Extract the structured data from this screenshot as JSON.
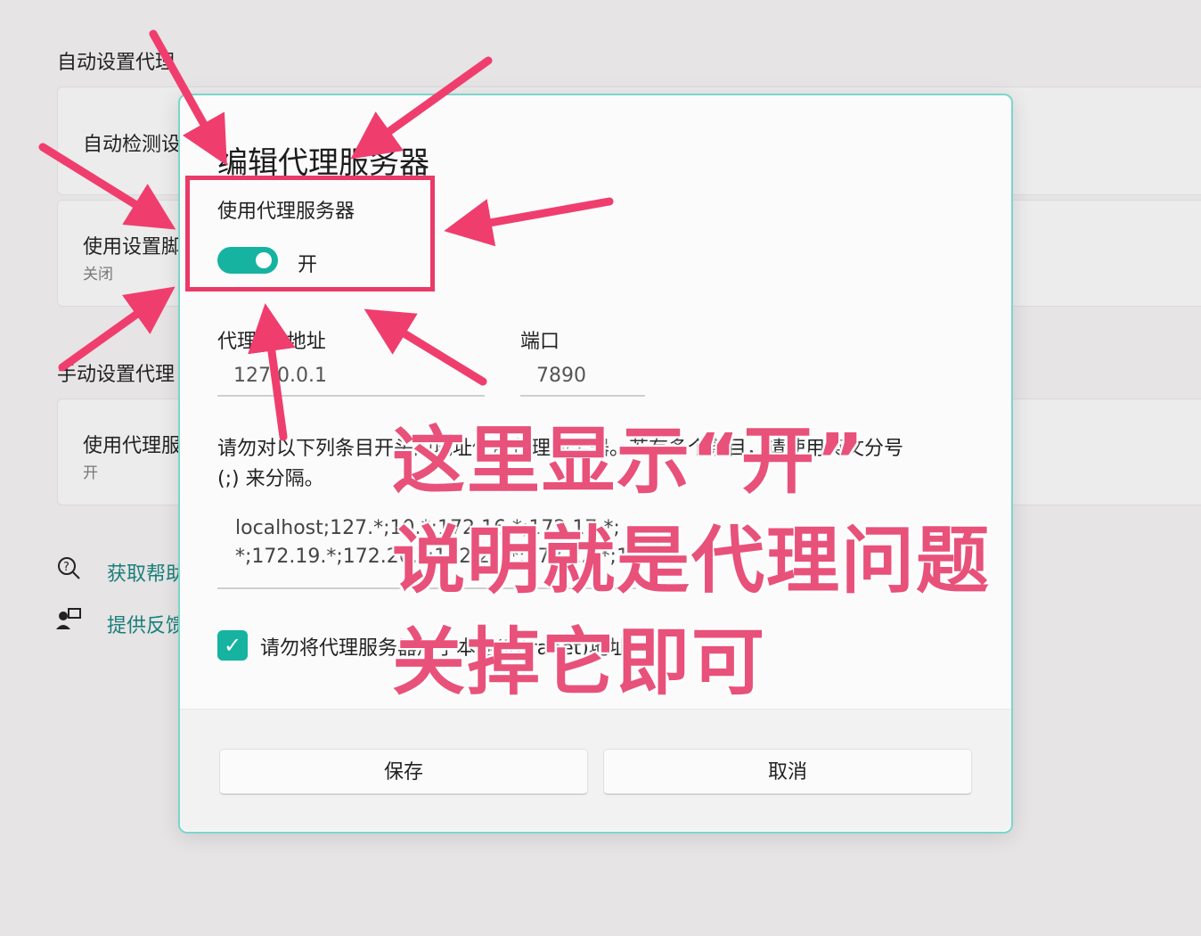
{
  "background": {
    "section_auto": "自动设置代理",
    "card_auto_detect": "自动检测设",
    "card_use_script": "使用设置脚",
    "card_use_script_state": "关闭",
    "section_manual": "手动设置代理",
    "card_use_proxy": "使用代理服",
    "card_use_proxy_state": "开",
    "link_help": "获取帮助",
    "link_feedback": "提供反馈"
  },
  "dialog": {
    "title": "编辑代理服务器",
    "use_proxy_label": "使用代理服务器",
    "toggle_state": "开",
    "address_label": "代理 IP 地址",
    "address_value": "127.0.0.1",
    "port_label": "端口",
    "port_value": "7890",
    "exceptions_desc_line1": "请勿对以下列条目开头的地址使用代理服务器。若有多个条目，请使用英文分号",
    "exceptions_desc_line2": "(;) 来分隔。",
    "exceptions_line1": "localhost;127.*;10.*;172.16.*;172.17.*;",
    "exceptions_line2": "*;172.19.*;172.20.*;172.21.*;172.22.*;172.23.*;",
    "checkbox_label": "请勿将代理服务器用于本地(Intranet)地址",
    "save_label": "保存",
    "cancel_label": "取消"
  },
  "annotation": {
    "line1": "这里显示“开”",
    "line2": "说明就是代理问题",
    "line3": "关掉它即可"
  },
  "colors": {
    "accent": "#15b3a0",
    "annotation": "#e8517a",
    "highlight": "#ea3a67"
  }
}
